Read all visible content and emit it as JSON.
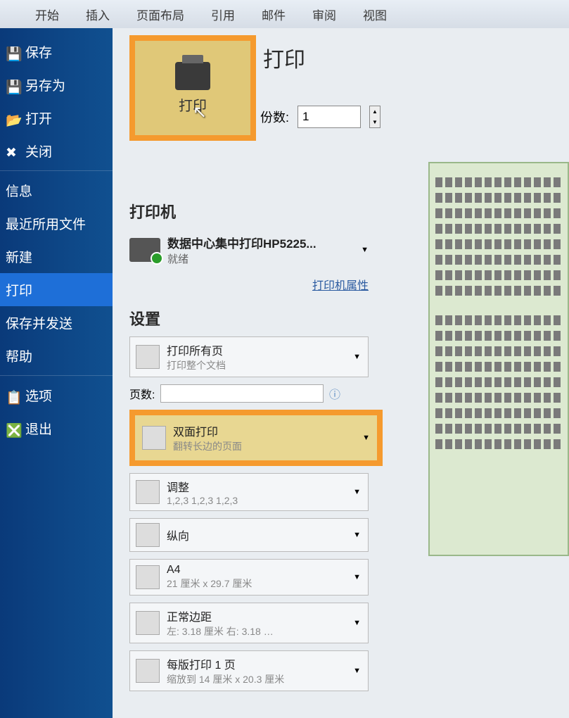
{
  "ribbon": {
    "tabs": [
      "开始",
      "插入",
      "页面布局",
      "引用",
      "邮件",
      "审阅",
      "视图"
    ]
  },
  "sidebar": {
    "save": "保存",
    "save_as": "另存为",
    "open": "打开",
    "close": "关闭",
    "info": "信息",
    "recent": "最近所用文件",
    "new": "新建",
    "print": "打印",
    "save_send": "保存并发送",
    "help": "帮助",
    "options": "选项",
    "exit": "退出"
  },
  "print": {
    "heading": "打印",
    "button_label": "打印",
    "copies_label": "份数:",
    "copies_value": "1",
    "printer_section": "打印机",
    "printer_name": "数据中心集中打印HP5225...",
    "printer_status": "就绪",
    "printer_props": "打印机属性",
    "settings_section": "设置",
    "setting_scope_main": "打印所有页",
    "setting_scope_sub": "打印整个文档",
    "pages_label": "页数:",
    "setting_duplex_main": "双面打印",
    "setting_duplex_sub": "翻转长边的页面",
    "setting_collate_main": "调整",
    "setting_collate_sub": "1,2,3    1,2,3    1,2,3",
    "setting_orient_main": "纵向",
    "setting_orient_sub": "",
    "setting_paper_main": "A4",
    "setting_paper_sub": "21 厘米 x 29.7 厘米",
    "setting_margin_main": "正常边距",
    "setting_margin_sub": "左: 3.18 厘米  右: 3.18 …",
    "setting_ppsheet_main": "每版打印 1 页",
    "setting_ppsheet_sub": "缩放到 14 厘米 x 20.3 厘米"
  }
}
